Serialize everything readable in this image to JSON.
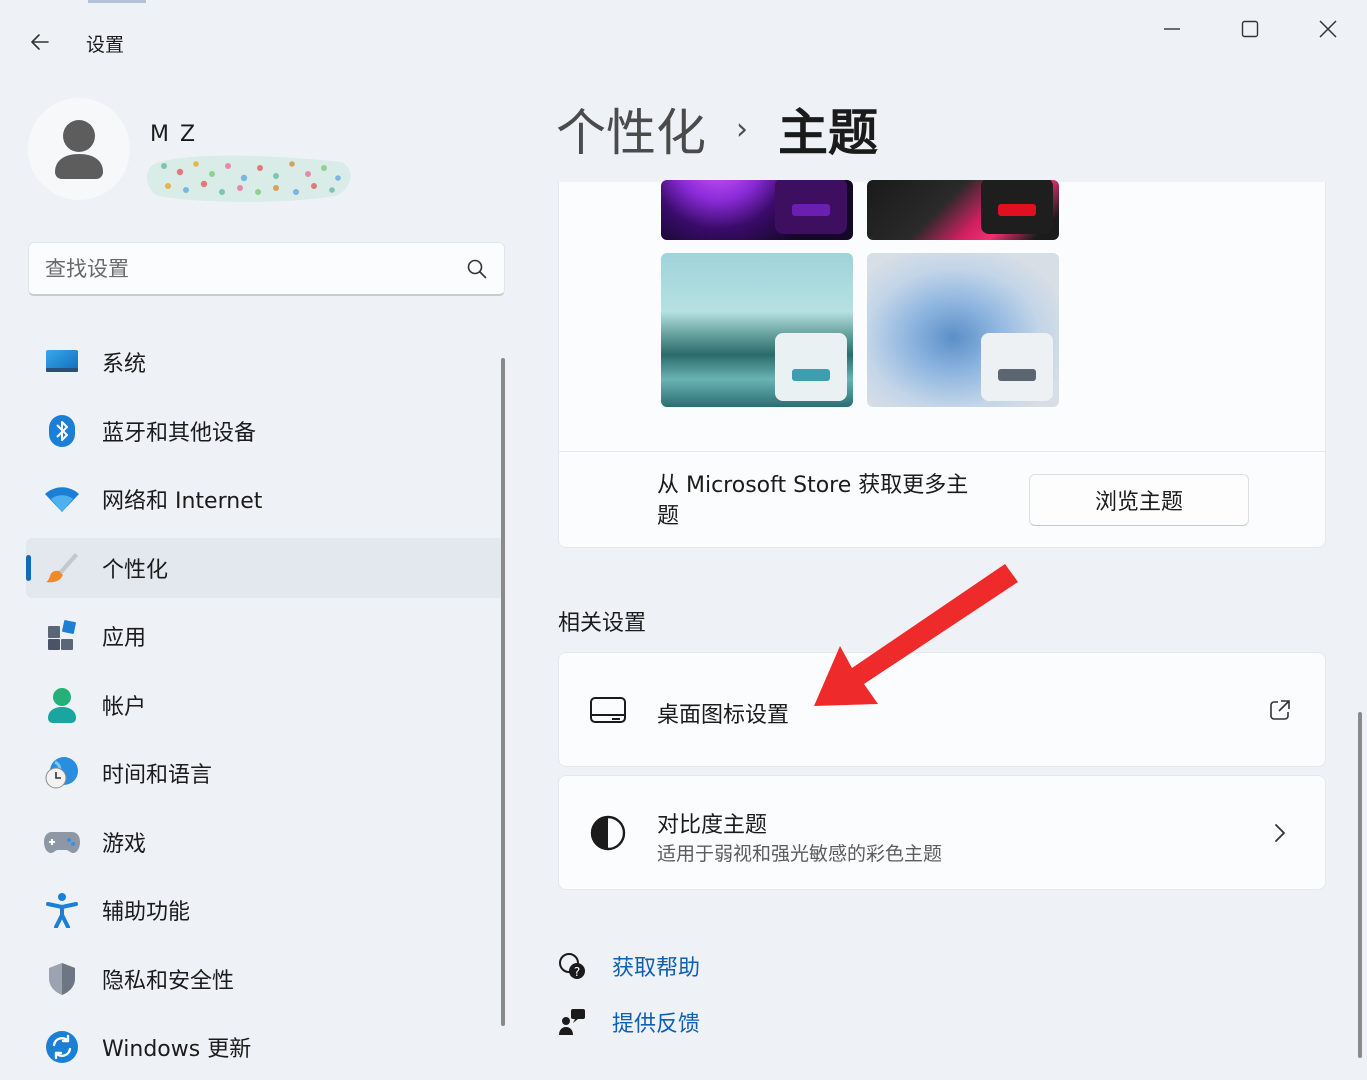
{
  "window": {
    "title": "设置",
    "controls": [
      "minimize",
      "maximize",
      "close"
    ]
  },
  "profile": {
    "name": "M Z"
  },
  "search": {
    "placeholder": "查找设置"
  },
  "nav": {
    "items": [
      {
        "label": "系统",
        "icon": "system-icon"
      },
      {
        "label": "蓝牙和其他设备",
        "icon": "bluetooth-icon"
      },
      {
        "label": "网络和 Internet",
        "icon": "wifi-icon"
      },
      {
        "label": "个性化",
        "icon": "brush-icon",
        "active": true
      },
      {
        "label": "应用",
        "icon": "apps-icon"
      },
      {
        "label": "帐户",
        "icon": "account-icon"
      },
      {
        "label": "时间和语言",
        "icon": "clock-globe-icon"
      },
      {
        "label": "游戏",
        "icon": "gamepad-icon"
      },
      {
        "label": "辅助功能",
        "icon": "accessibility-icon"
      },
      {
        "label": "隐私和安全性",
        "icon": "shield-icon"
      },
      {
        "label": "Windows 更新",
        "icon": "update-icon"
      }
    ]
  },
  "breadcrumb": {
    "parent": "个性化",
    "separator": "›",
    "current": "主题"
  },
  "themes": {
    "store_text": "从 Microsoft Store 获取更多主题",
    "browse_button": "浏览主题",
    "thumbnails": [
      "glow-purple",
      "flow-red",
      "captured-motion-teal",
      "bloom-light"
    ]
  },
  "related": {
    "title": "相关设置",
    "desktop_icons": {
      "title": "桌面图标设置",
      "icon": "monitor-icon",
      "end_icon": "open-external-icon"
    },
    "contrast": {
      "title": "对比度主题",
      "subtitle": "适用于弱视和强光敏感的彩色主题",
      "icon": "contrast-icon",
      "end_icon": "chevron-right-icon"
    }
  },
  "links": {
    "help": "获取帮助",
    "feedback": "提供反馈"
  },
  "colors": {
    "accent": "#0f6cbd",
    "annotation_arrow": "#ee2a2a",
    "link": "#0f5fb3"
  }
}
